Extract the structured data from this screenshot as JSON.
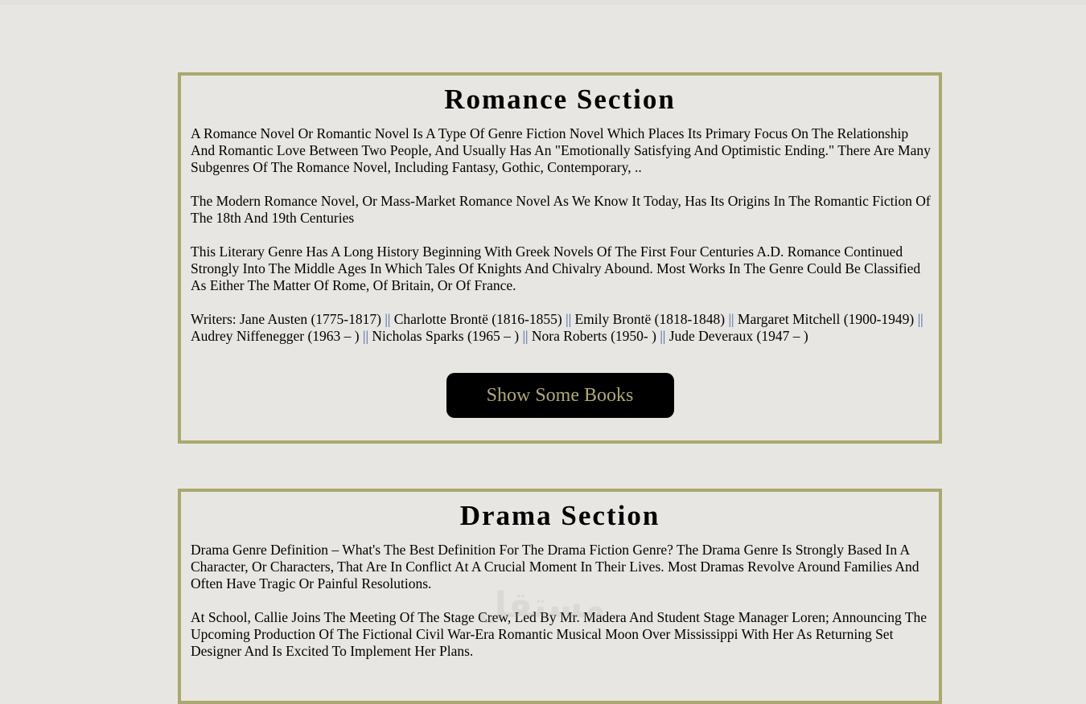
{
  "romance": {
    "title": "Romance Section",
    "paragraphs": [
      "A Romance Novel Or Romantic Novel Is A Type Of Genre Fiction Novel Which Places Its Primary Focus On The Relationship And Romantic Love Between Two People, And Usually Has An \"Emotionally Satisfying And Optimistic Ending.\" There Are Many Subgenres Of The Romance Novel, Including Fantasy, Gothic, Contemporary, ..",
      "The Modern Romance Novel, Or Mass-Market Romance Novel As We Know It Today, Has Its Origins In The Romantic Fiction Of The 18th And 19th Centuries",
      "This Literary Genre Has A Long History Beginning With Greek Novels Of The First Four Centuries A.D. Romance Continued Strongly Into The Middle Ages In Which Tales Of Knights And Chivalry Abound. Most Works In The Genre Could Be Classified As Either The Matter Of Rome, Of Britain, Or Of France."
    ],
    "writers_label": "Writers:",
    "writers": [
      "Jane Austen (1775-1817)",
      "Charlotte Brontë (1816-1855)",
      "Emily Brontë (1818-1848)",
      "Margaret Mitchell (1900-1949)",
      "Audrey Niffenegger (1963 – )",
      "Nicholas Sparks (1965 – )",
      "Nora Roberts (1950- )",
      "Jude Deveraux (1947 – )"
    ],
    "separator": "||",
    "button_label": "Show Some Books"
  },
  "drama": {
    "title": "Drama Section",
    "paragraphs": [
      "Drama Genre Definition – What's The Best Definition For The Drama Fiction Genre? The Drama Genre Is Strongly Based In A Character, Or Characters, That Are In Conflict At A Crucial Moment In Their Lives. Most Dramas Revolve Around Families And Often Have Tragic Or Painful Resolutions.",
      "At School, Callie Joins The Meeting Of The Stage Crew, Led By Mr. Madera And Student Stage Manager Loren; Announcing The Upcoming Production Of The Fictional Civil War-Era Romantic Musical Moon Over Mississippi With Her As Returning Set Designer And Is Excited To Implement Her Plans."
    ]
  },
  "watermark": "مستقل"
}
